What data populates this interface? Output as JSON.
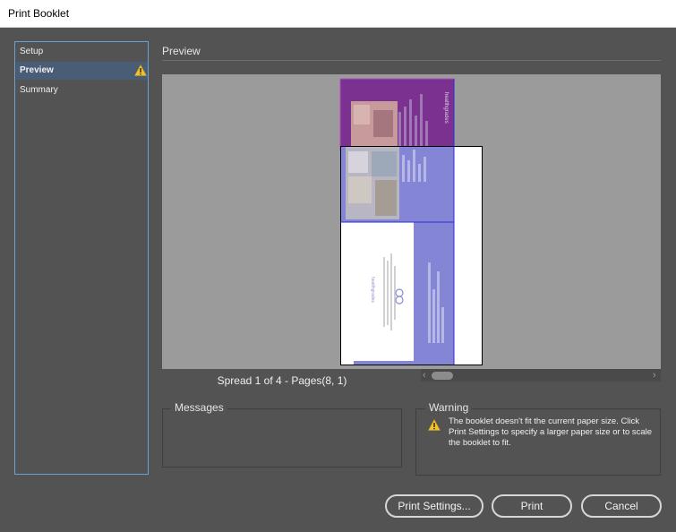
{
  "window": {
    "title": "Print Booklet"
  },
  "nav": {
    "items": [
      {
        "label": "Setup",
        "selected": false,
        "warning": false
      },
      {
        "label": "Preview",
        "selected": true,
        "warning": true
      },
      {
        "label": "Summary",
        "selected": false,
        "warning": false
      }
    ]
  },
  "preview": {
    "heading": "Preview",
    "spread_text": "Spread 1 of 4 - Pages(8, 1)",
    "brand_text": "healthgrades"
  },
  "messages": {
    "label": "Messages"
  },
  "warning": {
    "label": "Warning",
    "text": "The booklet doesn't fit the current paper size. Click Print Settings to specify a larger paper size or to scale the booklet to fit."
  },
  "buttons": {
    "print_settings": "Print Settings...",
    "print": "Print",
    "cancel": "Cancel"
  },
  "colors": {
    "background": "#535353",
    "nav_selected": "#4a5d76",
    "nav_border": "#6c9fd8",
    "warning_icon": "#f2c12e",
    "page_purple": "#7b3190",
    "page_lavender": "#8585d6"
  },
  "icons": {
    "warning": "warning-icon",
    "scroll_left": "chevron-left-icon",
    "scroll_right": "chevron-right-icon"
  }
}
